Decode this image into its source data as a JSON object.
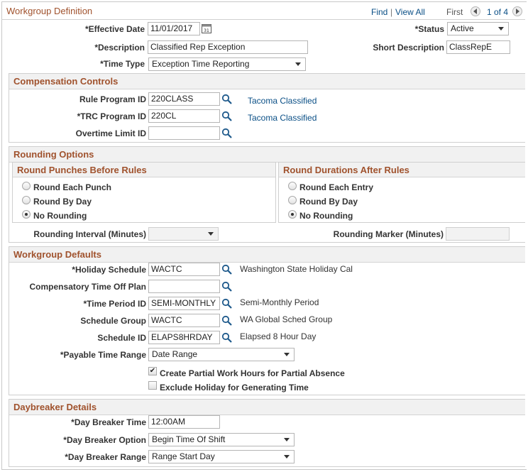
{
  "page": {
    "title": "Workgroup Definition",
    "find": "Find",
    "view_all": "View All",
    "separator": "|",
    "first": "First",
    "counter": "1 of 4"
  },
  "header": {
    "effective_date_label": "*Effective Date",
    "effective_date": "11/01/2017",
    "status_label": "*Status",
    "status": "Active",
    "description_label": "*Description",
    "description": "Classified Rep Exception",
    "short_description_label": "Short Description",
    "short_description": "ClassRepE",
    "time_type_label": "*Time Type",
    "time_type": "Exception Time Reporting"
  },
  "compensation": {
    "title": "Compensation Controls",
    "rule_program_label": "Rule Program ID",
    "rule_program": "220CLASS",
    "rule_program_desc": "Tacoma Classified",
    "trc_program_label": "*TRC Program ID",
    "trc_program": "220CL",
    "trc_program_desc": "Tacoma Classified",
    "overtime_label": "Overtime Limit ID",
    "overtime": ""
  },
  "rounding": {
    "title": "Rounding Options",
    "punches": {
      "title": "Round Punches Before Rules",
      "options": [
        "Round Each Punch",
        "Round By Day",
        "No Rounding"
      ],
      "selected": 2
    },
    "durations": {
      "title": "Round Durations After Rules",
      "options": [
        "Round Each Entry",
        "Round By Day",
        "No Rounding"
      ],
      "selected": 2
    },
    "interval_label": "Rounding Interval (Minutes)",
    "interval": "",
    "marker_label": "Rounding Marker (Minutes)",
    "marker": ""
  },
  "defaults": {
    "title": "Workgroup Defaults",
    "holiday_label": "*Holiday Schedule",
    "holiday": "WACTC",
    "holiday_desc": "Washington State Holiday Cal",
    "comp_time_label": "Compensatory Time Off Plan",
    "comp_time": "",
    "time_period_label": "*Time Period ID",
    "time_period": "SEMI-MONTHLY",
    "time_period_desc": "Semi-Monthly Period",
    "schedule_group_label": "Schedule Group",
    "schedule_group": "WACTC",
    "schedule_group_desc": "WA Global Sched Group",
    "schedule_id_label": "Schedule ID",
    "schedule_id": "ELAPS8HRDAY",
    "schedule_id_desc": "Elapsed 8 Hour Day",
    "payable_range_label": "*Payable Time Range",
    "payable_range": "Date Range",
    "partial_hours_label": "Create Partial Work Hours for Partial Absence",
    "partial_hours_checked": true,
    "exclude_holiday_label": "Exclude Holiday for Generating Time",
    "exclude_holiday_checked": false
  },
  "daybreaker": {
    "title": "Daybreaker Details",
    "time_label": "*Day Breaker Time",
    "time": "12:00AM",
    "option_label": "*Day Breaker Option",
    "option": "Begin Time Of Shift",
    "range_label": "*Day Breaker Range",
    "range": "Range Start Day"
  },
  "colors": {
    "section_title": "#a0522d",
    "link": "#0a4f86"
  },
  "icons": {
    "lookup": "magnifier-icon",
    "calendar": "calendar-icon",
    "nav_prev": "triangle-left-icon",
    "nav_next": "triangle-right-icon"
  }
}
